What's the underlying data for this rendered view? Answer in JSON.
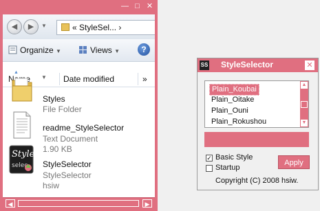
{
  "explorer": {
    "address_text": "« StyleSel... ›",
    "toolbar": {
      "organize_label": "Organize",
      "views_label": "Views"
    },
    "columns": {
      "name": "Name",
      "date_modified": "Date modified",
      "more": "»"
    },
    "files": [
      {
        "name": "Styles",
        "line2": "File Folder",
        "line3": ""
      },
      {
        "name": "readme_StyleSelector",
        "line2": "Text Document",
        "line3": "1.90 KB"
      },
      {
        "name": "StyleSelector",
        "line2": "StyleSelector",
        "line3": "hsiw"
      }
    ]
  },
  "style_selector": {
    "title": "StyleSelector",
    "list_items": [
      "Plain_Koubai",
      "Plain_Oitake",
      "Plain_Ouni",
      "Plain_Rokushou"
    ],
    "selected_index": 0,
    "basic_style_label": "Basic Style",
    "basic_style_checked": true,
    "startup_label": "Startup",
    "startup_checked": false,
    "apply_label": "Apply",
    "copyright": "Copyright (C) 2008 hsiw."
  },
  "colors": {
    "accent": "#e06f80"
  }
}
